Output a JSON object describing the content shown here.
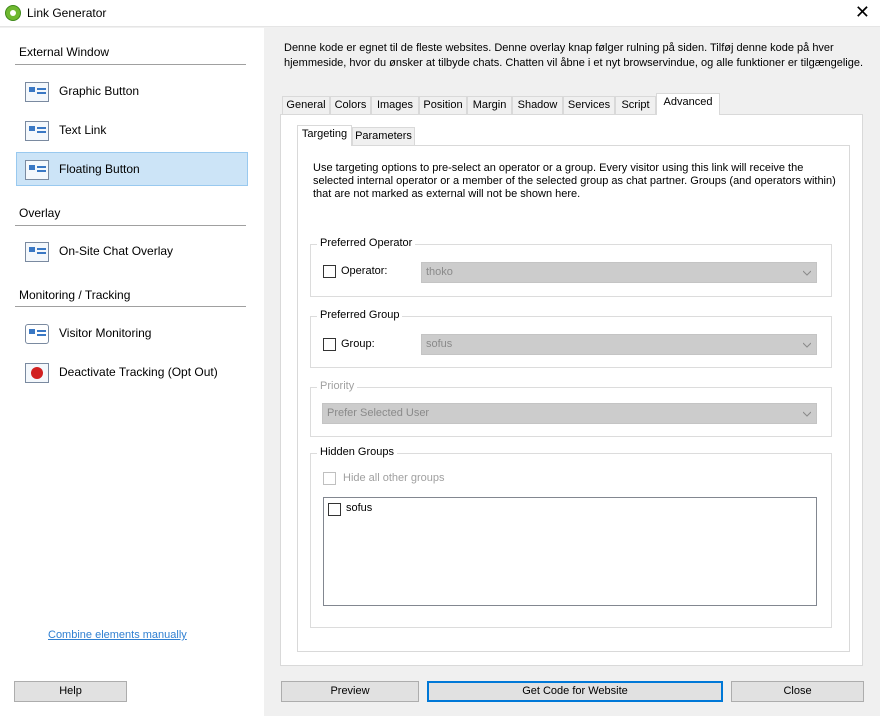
{
  "window": {
    "title": "Link Generator",
    "close_glyph": "✕"
  },
  "sidebar": {
    "sections": [
      {
        "title": "External Window"
      },
      {
        "title": "Overlay"
      },
      {
        "title": "Monitoring / Tracking"
      }
    ],
    "items": [
      {
        "label": "Graphic Button",
        "icon": "graphic-button-icon"
      },
      {
        "label": "Text Link",
        "icon": "text-link-icon"
      },
      {
        "label": "Floating Button",
        "icon": "floating-button-icon",
        "selected": true
      },
      {
        "label": "On-Site Chat Overlay",
        "icon": "chat-overlay-icon"
      },
      {
        "label": "Visitor Monitoring",
        "icon": "visitor-monitoring-icon"
      },
      {
        "label": "Deactivate Tracking (Opt Out)",
        "icon": "opt-out-icon"
      }
    ],
    "combine_link": "Combine elements manually"
  },
  "description": "Denne kode er egnet til de fleste websites. Denne overlay knap følger rulning på siden. Tilføj denne kode på hver hjemmeside, hvor du ønsker at tilbyde chats. Chatten vil åbne i et nyt browservindue, og alle funktioner er tilgængelige.",
  "tabs": [
    {
      "label": "General"
    },
    {
      "label": "Colors"
    },
    {
      "label": "Images"
    },
    {
      "label": "Position"
    },
    {
      "label": "Margin"
    },
    {
      "label": "Shadow"
    },
    {
      "label": "Services"
    },
    {
      "label": "Script"
    },
    {
      "label": "Advanced",
      "active": true
    }
  ],
  "subtabs": [
    {
      "label": "Targeting",
      "active": true
    },
    {
      "label": "Parameters"
    }
  ],
  "targeting": {
    "intro": "Use targeting options to pre-select an operator or a group. Every visitor using this link will receive the selected internal operator or a member of the selected group as chat partner. Groups (and operators within) that are not marked as external will not be shown here.",
    "preferred_operator": {
      "title": "Preferred Operator",
      "label": "Operator:",
      "value": "thoko"
    },
    "preferred_group": {
      "title": "Preferred Group",
      "label": "Group:",
      "value": "sofus"
    },
    "priority": {
      "title": "Priority",
      "value": "Prefer Selected User"
    },
    "hidden_groups": {
      "title": "Hidden Groups",
      "hide_all_label": "Hide all other groups",
      "items": [
        {
          "label": "sofus"
        }
      ]
    }
  },
  "buttons": {
    "help": "Help",
    "preview": "Preview",
    "get_code": "Get Code for Website",
    "close": "Close"
  }
}
